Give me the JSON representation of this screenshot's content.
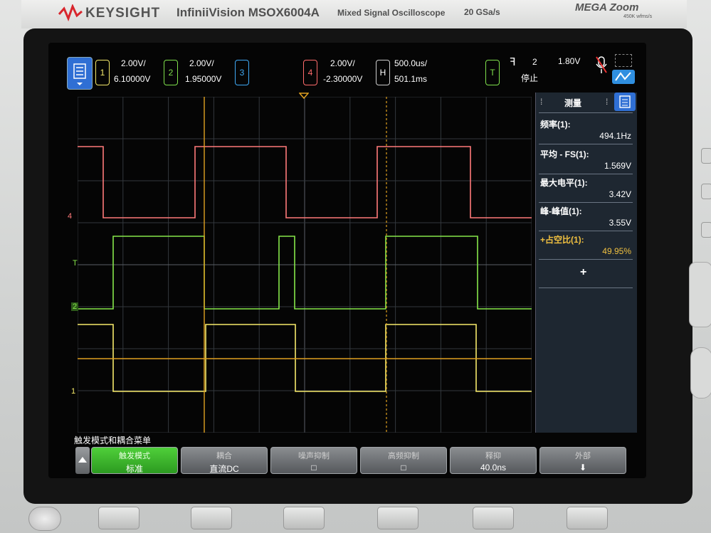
{
  "device": {
    "brand": "KEYSIGHT",
    "model": "InfiniiVision MSOX6004A",
    "subtitle": "Mixed Signal Oscilloscope",
    "sample_rate": "20 GSa/s",
    "megazoom": "MEGA Zoom",
    "megazoom_sub": "450K wfms/s"
  },
  "status": {
    "ch1": {
      "num": "1",
      "scale": "2.00V/",
      "offset": "6.10000V",
      "color": "#f3e86a"
    },
    "ch2": {
      "num": "2",
      "scale": "2.00V/",
      "offset": "1.95000V",
      "color": "#7fe04b"
    },
    "ch3": {
      "num": "3",
      "color": "#3fa9f5"
    },
    "ch4": {
      "num": "4",
      "scale": "2.00V/",
      "offset": "-2.30000V",
      "color": "#ff6b6b"
    },
    "horizontal": {
      "label": "H",
      "scale": "500.0us/",
      "delay": "501.1ms"
    },
    "trigger": {
      "label": "T",
      "edge_symbol": "ꟻ",
      "source": "2",
      "level": "1.80V",
      "state": "停止"
    }
  },
  "measurements": {
    "title": "测量",
    "items": [
      {
        "label": "频率(1):",
        "value": "494.1Hz",
        "highlight": false
      },
      {
        "label": "平均 - FS(1):",
        "value": "1.569V",
        "highlight": false
      },
      {
        "label": "最大电平(1):",
        "value": "3.42V",
        "highlight": false
      },
      {
        "label": "峰-峰值(1):",
        "value": "3.55V",
        "highlight": false
      },
      {
        "label": "+占空比(1):",
        "value": "49.95%",
        "highlight": true
      }
    ],
    "add_symbol": "+"
  },
  "menu": {
    "title": "触发模式和耦合菜单",
    "keys": [
      {
        "title": "触发模式",
        "value": "标准"
      },
      {
        "title": "耦合",
        "value": "直流DC"
      },
      {
        "title": "噪声抑制",
        "value": "□"
      },
      {
        "title": "高频抑制",
        "value": "□"
      },
      {
        "title": "释抑",
        "value": "40.0ns"
      },
      {
        "title": "外部",
        "value": "⬇"
      }
    ]
  },
  "markers": {
    "ch4": "4",
    "ch2": "2",
    "ch1": "1",
    "trig": "T"
  },
  "colors": {
    "ch1": "#f3e86a",
    "ch2": "#7fe04b",
    "ch4": "#ff7070",
    "grid": "#3a3f44",
    "panel": "#1e2731"
  }
}
